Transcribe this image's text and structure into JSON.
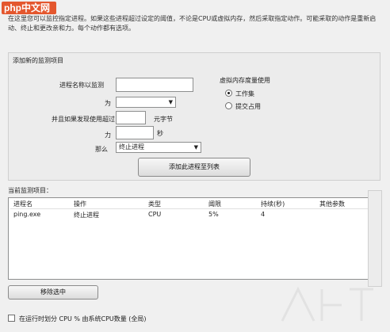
{
  "logo": {
    "text": "php中文网"
  },
  "description": "在这里您可以监控指定进程。如果这些进程超过设定的阈值，不论是CPU或虚拟内存，然后采取指定动作。可能采取的动作是重新启动、终止和更改亲和力。每个动作都有选项。",
  "new_monitor": {
    "group_label": "添加新的监测项目",
    "process_name_label": "进程名称以监测",
    "process_name_value": "",
    "for_label": "为",
    "for_value": "",
    "and_if_label": "并且如果发现使用超过",
    "threshold_value": "",
    "unit_label": "元字节",
    "for2_label": "力",
    "seconds_value": "",
    "seconds_label": "秒",
    "then_label": "那么",
    "action_value": "终止进程",
    "add_button": "添加此进程至列表",
    "memory_group_label": "虚拟内存度量使用",
    "radio_working_set": "工作集",
    "radio_commit": "提交占用"
  },
  "current": {
    "label": "当前监测项目：",
    "columns": [
      "进程名",
      "操作",
      "类型",
      "阈限",
      "持续(秒)",
      "其他参数"
    ],
    "rows": [
      [
        "ping.exe",
        "终止进程",
        "CPU",
        "5%",
        "4",
        ""
      ]
    ]
  },
  "remove_button": "移除选中",
  "footer_checkbox": "在运行时划分 CPU % 由系统CPU数量 (全局)"
}
